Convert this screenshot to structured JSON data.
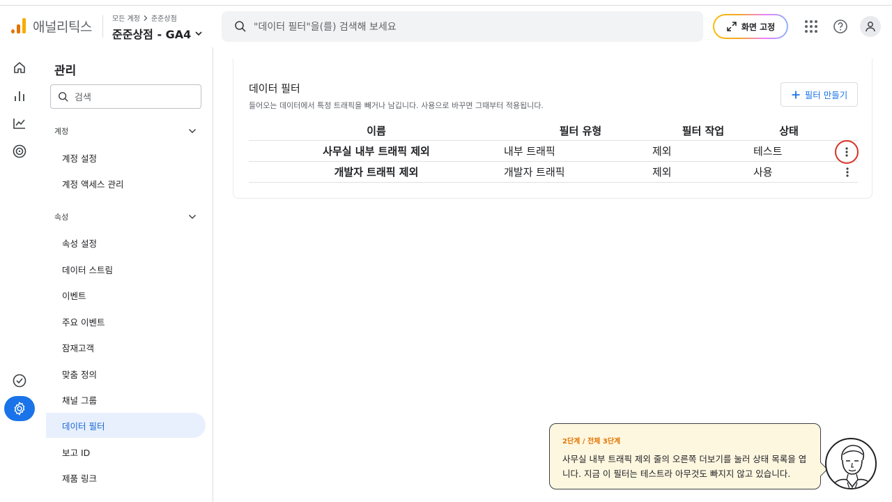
{
  "header": {
    "brand": "애널리틱스",
    "breadcrumb": {
      "root": "모든 계정",
      "account": "준준상점"
    },
    "property": "준준상점 - GA4",
    "search_placeholder": "\"데이터 필터\"을(를) 검색해 보세요",
    "pin_label": "화면 고정"
  },
  "sidebar": {
    "title": "관리",
    "search_placeholder": "검색",
    "sections": [
      {
        "label": "계정",
        "items": [
          "계정 설정",
          "계정 액세스 관리"
        ]
      },
      {
        "label": "속성",
        "items": [
          "속성 설정",
          "데이터 스트림",
          "이벤트",
          "주요 이벤트",
          "잠재고객",
          "맞춤 정의",
          "채널 그룹",
          "데이터 필터",
          "보고 ID",
          "제품 링크"
        ]
      }
    ],
    "active_item": "데이터 필터"
  },
  "main": {
    "title": "데이터 필터",
    "subtitle": "들어오는 데이터에서 특정 트래픽을 빼거나 남깁니다. 사용으로 바꾸면 그때부터 적용됩니다.",
    "new_button": "필터 만들기",
    "columns": [
      "이름",
      "필터 유형",
      "필터 작업",
      "상태"
    ],
    "rows": [
      {
        "name": "사무실 내부 트래픽 제외",
        "type": "내부 트래픽",
        "action": "제외",
        "status": "테스트"
      },
      {
        "name": "개발자 트래픽 제외",
        "type": "개발자 트래픽",
        "action": "제외",
        "status": "사용"
      }
    ]
  },
  "tour": {
    "step": "2단계 / 전체 3단계",
    "text": "사무실 내부 트래픽 제외 줄의 오른쪽 더보기를 눌러 상태 목록을 엽니다. 지금 이 필터는 테스트라 아무것도 빠지지 않고 있습니다."
  },
  "colors": {
    "accent": "#1a73e8",
    "active_bg": "#e8f0fe",
    "highlight": "#d93025",
    "tip_bg": "#fef7e0",
    "logo_orange": "#e37400"
  }
}
